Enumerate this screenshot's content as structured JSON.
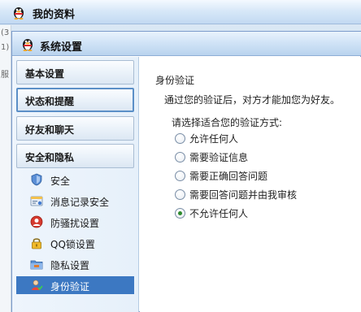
{
  "background_window": {
    "title": "我的资料",
    "strip_texts": [
      "(3",
      "1)",
      "服"
    ]
  },
  "window": {
    "title": "系统设置"
  },
  "nav": {
    "categories": [
      {
        "label": "基本设置"
      },
      {
        "label": "状态和提醒"
      },
      {
        "label": "好友和聊天"
      },
      {
        "label": "安全和隐私"
      }
    ],
    "sub_items": [
      {
        "label": "安全",
        "icon": "shield-icon"
      },
      {
        "label": "消息记录安全",
        "icon": "message-record-icon"
      },
      {
        "label": "防骚扰设置",
        "icon": "anti-harass-icon"
      },
      {
        "label": "QQ锁设置",
        "icon": "lock-icon"
      },
      {
        "label": "隐私设置",
        "icon": "privacy-folder-icon"
      },
      {
        "label": "身份验证",
        "icon": "identity-verify-icon",
        "active": true
      }
    ]
  },
  "content": {
    "section_title": "身份验证",
    "description": "通过您的验证后，对方才能加您为好友。",
    "prompt": "请选择适合您的验证方式:",
    "options": [
      {
        "label": "允许任何人",
        "checked": false
      },
      {
        "label": "需要验证信息",
        "checked": false
      },
      {
        "label": "需要正确回答问题",
        "checked": false
      },
      {
        "label": "需要回答问题并由我审核",
        "checked": false
      },
      {
        "label": "不允许任何人",
        "checked": true
      }
    ]
  },
  "colors": {
    "accent": "#3c78c2",
    "selected_radio": "#2d8a2d",
    "titlebar": "#cfe2f6"
  }
}
